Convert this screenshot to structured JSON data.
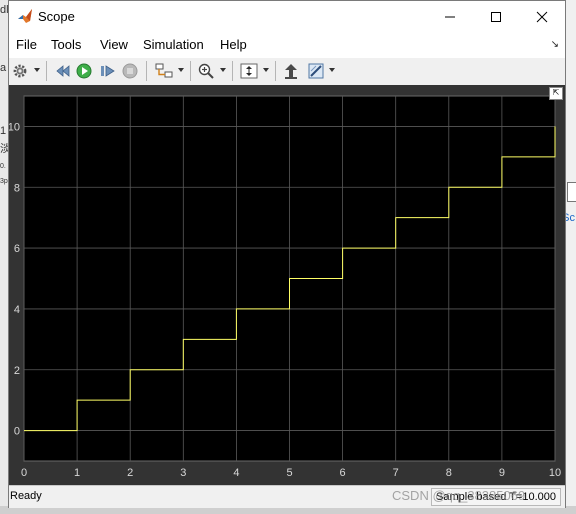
{
  "window": {
    "title": "Scope"
  },
  "menu": {
    "items": [
      "File",
      "Tools",
      "View",
      "Simulation",
      "Help"
    ]
  },
  "toolbar": {
    "icons": [
      "settings-gear-icon",
      "step-back-icon",
      "run-icon",
      "step-forward-icon",
      "stop-icon",
      "signal-selector-icon",
      "zoom-icon",
      "scale-axes-icon",
      "highlight-block-icon",
      "style-icon"
    ]
  },
  "chart_data": {
    "type": "line",
    "step": true,
    "x": [
      0,
      1,
      2,
      3,
      4,
      5,
      6,
      7,
      8,
      9,
      10
    ],
    "y": [
      0,
      1,
      2,
      3,
      4,
      5,
      6,
      7,
      8,
      9,
      10
    ],
    "xlim": [
      0,
      10
    ],
    "ylim": [
      -1,
      11
    ],
    "x_ticks": [
      "0",
      "1",
      "2",
      "3",
      "4",
      "5",
      "6",
      "7",
      "8",
      "9",
      "10"
    ],
    "y_ticks": [
      "0",
      "2",
      "4",
      "6",
      "8",
      "10"
    ],
    "grid": true,
    "line_color": "#ffff66",
    "background_color": "#000000",
    "frame_color": "#333333"
  },
  "status": {
    "left": "Ready",
    "right": "Sample based  T=10.000"
  },
  "watermark": "CSDN @qq_38385069",
  "background": {
    "fragments": [
      "dl",
      "a",
      "1",
      "淡",
      "1",
      "0.",
      "3p",
      "Sc"
    ]
  }
}
